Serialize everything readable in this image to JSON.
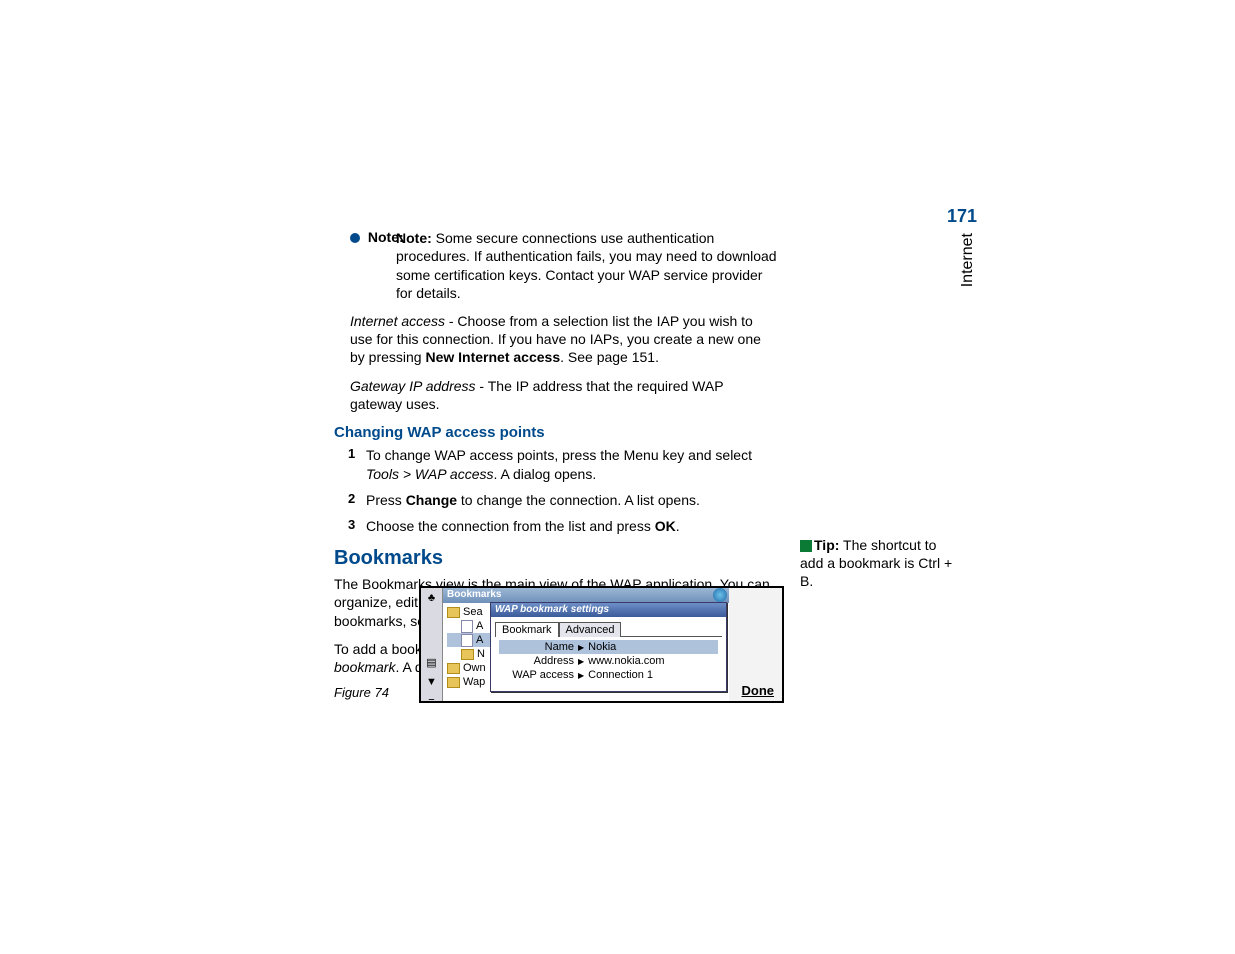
{
  "page_number": "171",
  "side_tab": "Internet",
  "note": {
    "label": "Note:",
    "text": "Some secure connections use authentication procedures. If authentication fails, you may need to download some certification keys. Contact your WAP service provider for details."
  },
  "para_internet_access": {
    "italic": "Internet access",
    "rest": " - Choose from a selection list the IAP you wish to use for this connection. If you have no IAPs, you create a new one by pressing ",
    "bold": "New Internet access",
    "tail": ". See page 151."
  },
  "para_gateway": {
    "italic": "Gateway IP address",
    "rest": " - The IP address that the required WAP gateway uses."
  },
  "heading_changing": "Changing WAP access points",
  "steps": [
    {
      "num": "1",
      "pre": "To change WAP access points, press the Menu key and select ",
      "italic": "Tools > WAP access",
      "post": ". A dialog opens."
    },
    {
      "num": "2",
      "pre": "Press ",
      "bold": "Change",
      "post": " to change the connection. A list opens."
    },
    {
      "num": "3",
      "pre": "Choose the connection from the list and press ",
      "bold": "OK",
      "post": "."
    }
  ],
  "heading_bookmarks": "Bookmarks",
  "bookmarks_para": "The Bookmarks view is the main view of the WAP application. You can organize, edit, and view these bookmarks in the same way as WWW bookmarks, see page 167.",
  "add_bookmark_para": {
    "pre": "To add a bookmark, press the Menu key, then select ",
    "italic": "Bookmarks > Add bookmark",
    "post": ". A dialog opens. See Figure 74."
  },
  "tip": {
    "label": "Tip:",
    "text": " The shortcut to add a bookmark is Ctrl + B."
  },
  "figure_label": "Figure 74",
  "figure": {
    "window_title": "Bookmarks",
    "tree": {
      "sea": "Sea",
      "own": "Own",
      "wap": "Wap",
      "a1": "A",
      "a2": "A",
      "n": "N"
    },
    "done": "Done",
    "dialog_title": "WAP bookmark settings",
    "tabs": {
      "bookmark": "Bookmark",
      "advanced": "Advanced"
    },
    "fields": {
      "name_label": "Name",
      "name_value": "Nokia",
      "address_label": "Address",
      "address_value": "www.nokia.com",
      "wap_label": "WAP access",
      "wap_value": "Connection 1"
    }
  }
}
